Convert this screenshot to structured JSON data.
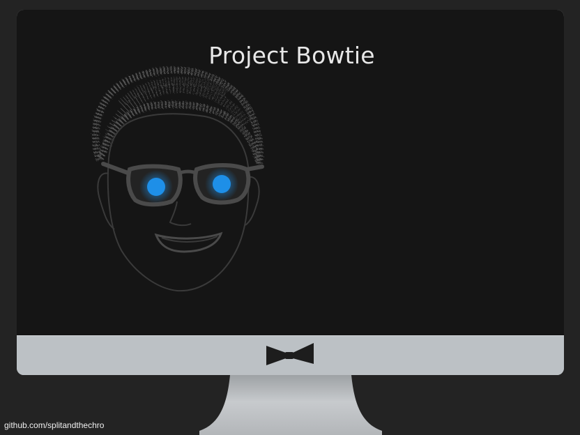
{
  "slide": {
    "title": "Project Bowtie"
  },
  "footer": {
    "link_text": "github.com/splitandthechro"
  },
  "colors": {
    "background": "#232323",
    "screen": "#151515",
    "bezel": "#bcc1c5",
    "eye_glow": "#1e8fe8",
    "title_text": "#e8e8e8"
  },
  "icons": {
    "logo": "bowtie-icon",
    "illustration": "glowing-eyes-face"
  }
}
